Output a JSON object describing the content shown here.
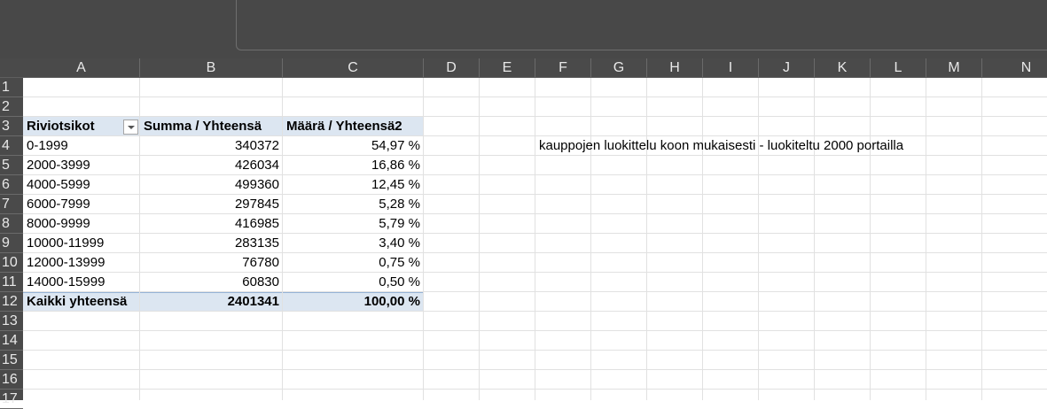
{
  "columns": [
    "A",
    "B",
    "C",
    "D",
    "E",
    "F",
    "G",
    "H",
    "I",
    "J",
    "K",
    "L",
    "M",
    "N"
  ],
  "rows": [
    "1",
    "2",
    "3",
    "4",
    "5",
    "6",
    "7",
    "8",
    "9",
    "10",
    "11",
    "12",
    "13",
    "14",
    "15",
    "16",
    "17"
  ],
  "pivot": {
    "header": {
      "row_labels": "Riviotsikot",
      "sum": "Summa  / Yhteensä",
      "count": "Määrä  / Yhteensä2"
    },
    "records": [
      {
        "label": "0-1999",
        "sum": "340372",
        "pct": "54,97 %"
      },
      {
        "label": "2000-3999",
        "sum": "426034",
        "pct": "16,86 %"
      },
      {
        "label": "4000-5999",
        "sum": "499360",
        "pct": "12,45 %"
      },
      {
        "label": "6000-7999",
        "sum": "297845",
        "pct": "5,28 %"
      },
      {
        "label": "8000-9999",
        "sum": "416985",
        "pct": "5,79 %"
      },
      {
        "label": "10000-11999",
        "sum": "283135",
        "pct": "3,40 %"
      },
      {
        "label": "12000-13999",
        "sum": "76780",
        "pct": "0,75 %"
      },
      {
        "label": "14000-15999",
        "sum": "60830",
        "pct": "0,50 %"
      }
    ],
    "total": {
      "label": "Kaikki yhteensä",
      "sum": "2401341",
      "pct": "100,00 %"
    }
  },
  "note": "kauppojen luokittelu koon mukaisesti - luokiteltu 2000 portailla",
  "colors": {
    "pivot_band": "#dce6f1",
    "header_bg": "#4a4a4a",
    "topbar": "#484848"
  }
}
